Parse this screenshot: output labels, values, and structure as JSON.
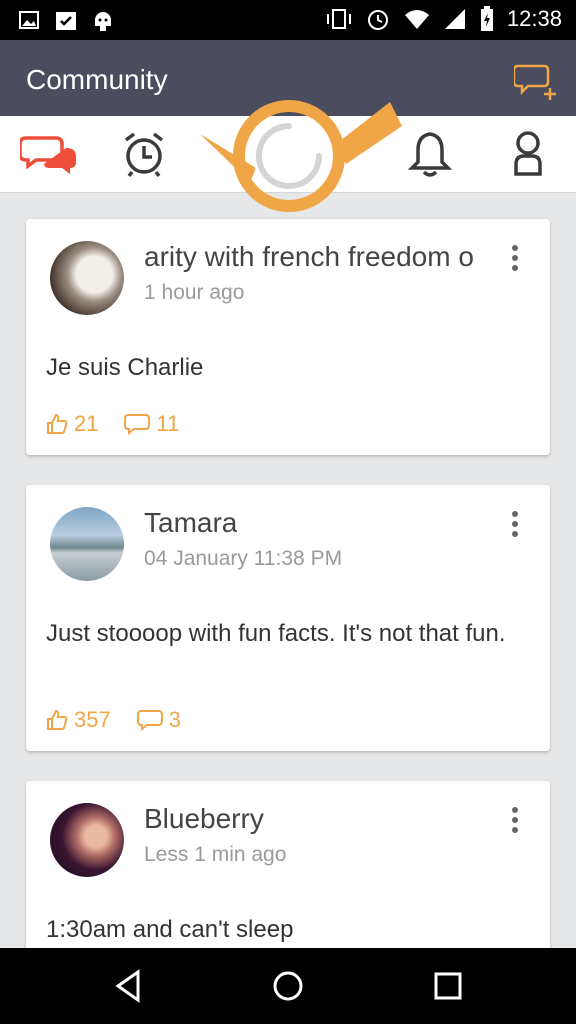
{
  "status_bar": {
    "time": "12:38",
    "left_icons": [
      "image-icon",
      "clipboard-check-icon",
      "android-icon"
    ],
    "right_icons": [
      "vibrate-icon",
      "alarm-icon",
      "wifi-icon",
      "signal-icon",
      "battery-charging-icon"
    ]
  },
  "app_bar": {
    "title": "Community",
    "action_icon": "new-chat-icon"
  },
  "tabs": [
    {
      "name": "chat",
      "icon": "chat-bubbles-icon",
      "active": true
    },
    {
      "name": "alarm",
      "icon": "alarm-clock-icon",
      "active": false
    },
    {
      "name": "horn",
      "icon": "horn-loading-icon",
      "active": false
    },
    {
      "name": "notifications",
      "icon": "bell-icon",
      "active": false
    },
    {
      "name": "profile",
      "icon": "person-icon",
      "active": false
    }
  ],
  "posts": [
    {
      "author": "arity with french freedom o",
      "time": "1 hour ago",
      "body": "Je suis Charlie",
      "likes": "21",
      "comments": "11"
    },
    {
      "author": "Tamara",
      "time": "04 January 11:38 PM",
      "body": "Just stoooop with fun facts. It's not that fun.",
      "likes": "357",
      "comments": "3"
    },
    {
      "author": "Blueberry",
      "time": "Less 1 min ago",
      "body": "1:30am and can't sleep",
      "likes": "",
      "comments": ""
    }
  ],
  "nav": [
    "back-icon",
    "home-icon",
    "recents-icon"
  ],
  "colors": {
    "accent": "#f0a646",
    "chat_tab": "#ef4f3a",
    "appbar": "#4b4c5e"
  }
}
